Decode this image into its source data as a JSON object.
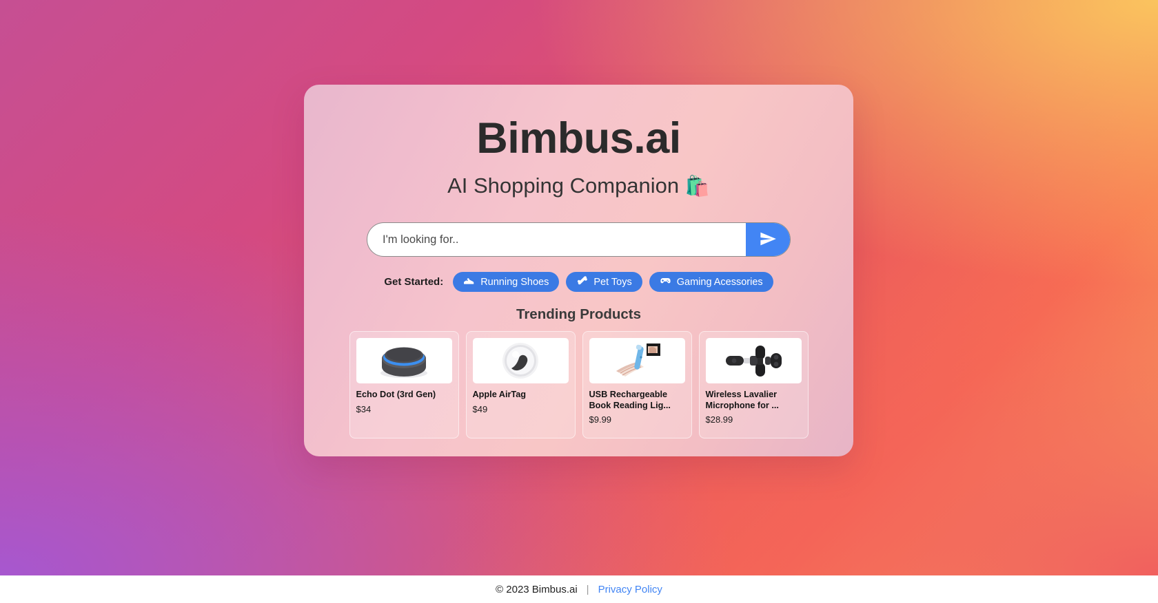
{
  "app": {
    "title": "Bimbus.ai",
    "tagline": "AI Shopping Companion",
    "tagline_emoji": "🛍️"
  },
  "search": {
    "placeholder": "I'm looking for..",
    "value": "",
    "send_icon": "send-icon"
  },
  "get_started": {
    "label": "Get Started:",
    "chips": [
      {
        "label": "Running Shoes",
        "icon": "running-shoe-icon",
        "emoji": "👟",
        "color": "#3b7ae4"
      },
      {
        "label": "Pet Toys",
        "icon": "pet-bone-icon",
        "emoji": "🦴",
        "color": "#3b7ae4"
      },
      {
        "label": "Gaming Acessories",
        "icon": "gamepad-icon",
        "emoji": "🎮",
        "color": "#3b7ae4"
      }
    ]
  },
  "trending": {
    "title": "Trending Products",
    "products": [
      {
        "name": "Echo Dot (3rd Gen)",
        "price": "$34",
        "image": "echo-dot-speaker-image"
      },
      {
        "name": "Apple AirTag",
        "price": "$49",
        "image": "apple-airtag-image"
      },
      {
        "name": "USB Rechargeable Book Reading Lig...",
        "price": "$9.99",
        "image": "book-reading-light-image"
      },
      {
        "name": "Wireless Lavalier Microphone for ...",
        "price": "$28.99",
        "image": "lavalier-microphone-image"
      }
    ]
  },
  "footer": {
    "copyright": "© 2023 Bimbus.ai",
    "separator": "|",
    "privacy_label": "Privacy Policy",
    "link_color": "#4285f4"
  },
  "theme": {
    "accent_blue": "#4285f4",
    "chip_blue": "#3b7ae4",
    "bg_top_left": "#c64f93",
    "bg_top_right": "#fbc95f",
    "bg_bottom_left": "#a458d4",
    "bg_bottom_right": "#f05a5e",
    "card_pink": "#f4c2cc"
  }
}
